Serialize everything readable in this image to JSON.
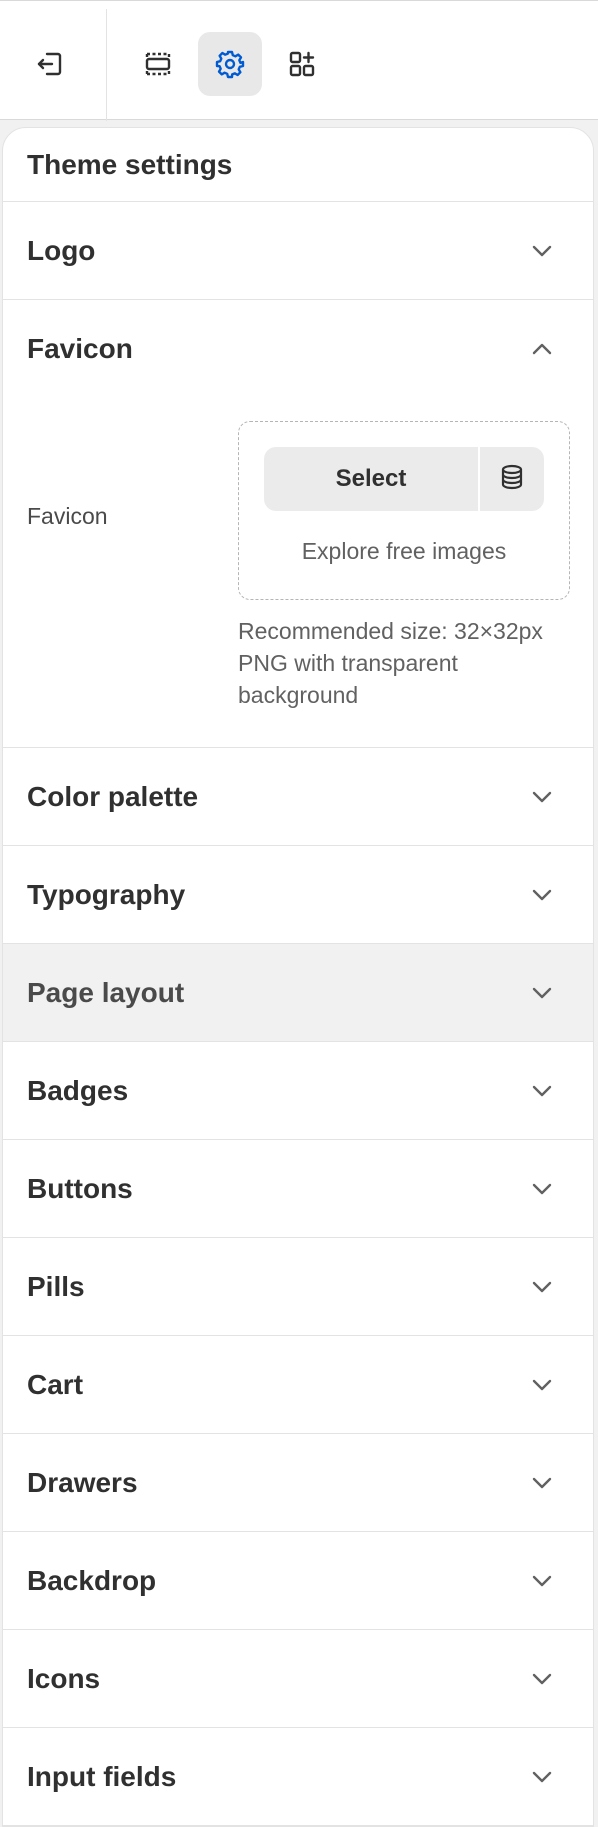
{
  "toolbar": {
    "buttons": [
      {
        "name": "exit-icon",
        "active": false
      },
      {
        "name": "sections-icon",
        "active": false
      },
      {
        "name": "settings-gear-icon",
        "active": true
      },
      {
        "name": "apps-icon",
        "active": false
      }
    ],
    "accent_color": "#005bd3"
  },
  "panel": {
    "title": "Theme settings"
  },
  "sections": {
    "logo": "Logo",
    "favicon": "Favicon",
    "color_palette": "Color palette",
    "typography": "Typography",
    "page_layout": "Page layout",
    "badges": "Badges",
    "buttons": "Buttons",
    "pills": "Pills",
    "cart": "Cart",
    "drawers": "Drawers",
    "backdrop": "Backdrop",
    "icons": "Icons",
    "input_fields": "Input fields"
  },
  "favicon": {
    "expanded": true,
    "field_label": "Favicon",
    "select_label": "Select",
    "explore_label": "Explore free images",
    "help_line1": "Recommended size: 32×32px",
    "help_line2": "PNG with transparent",
    "help_line3": "background"
  },
  "hovered_section": "Page layout"
}
